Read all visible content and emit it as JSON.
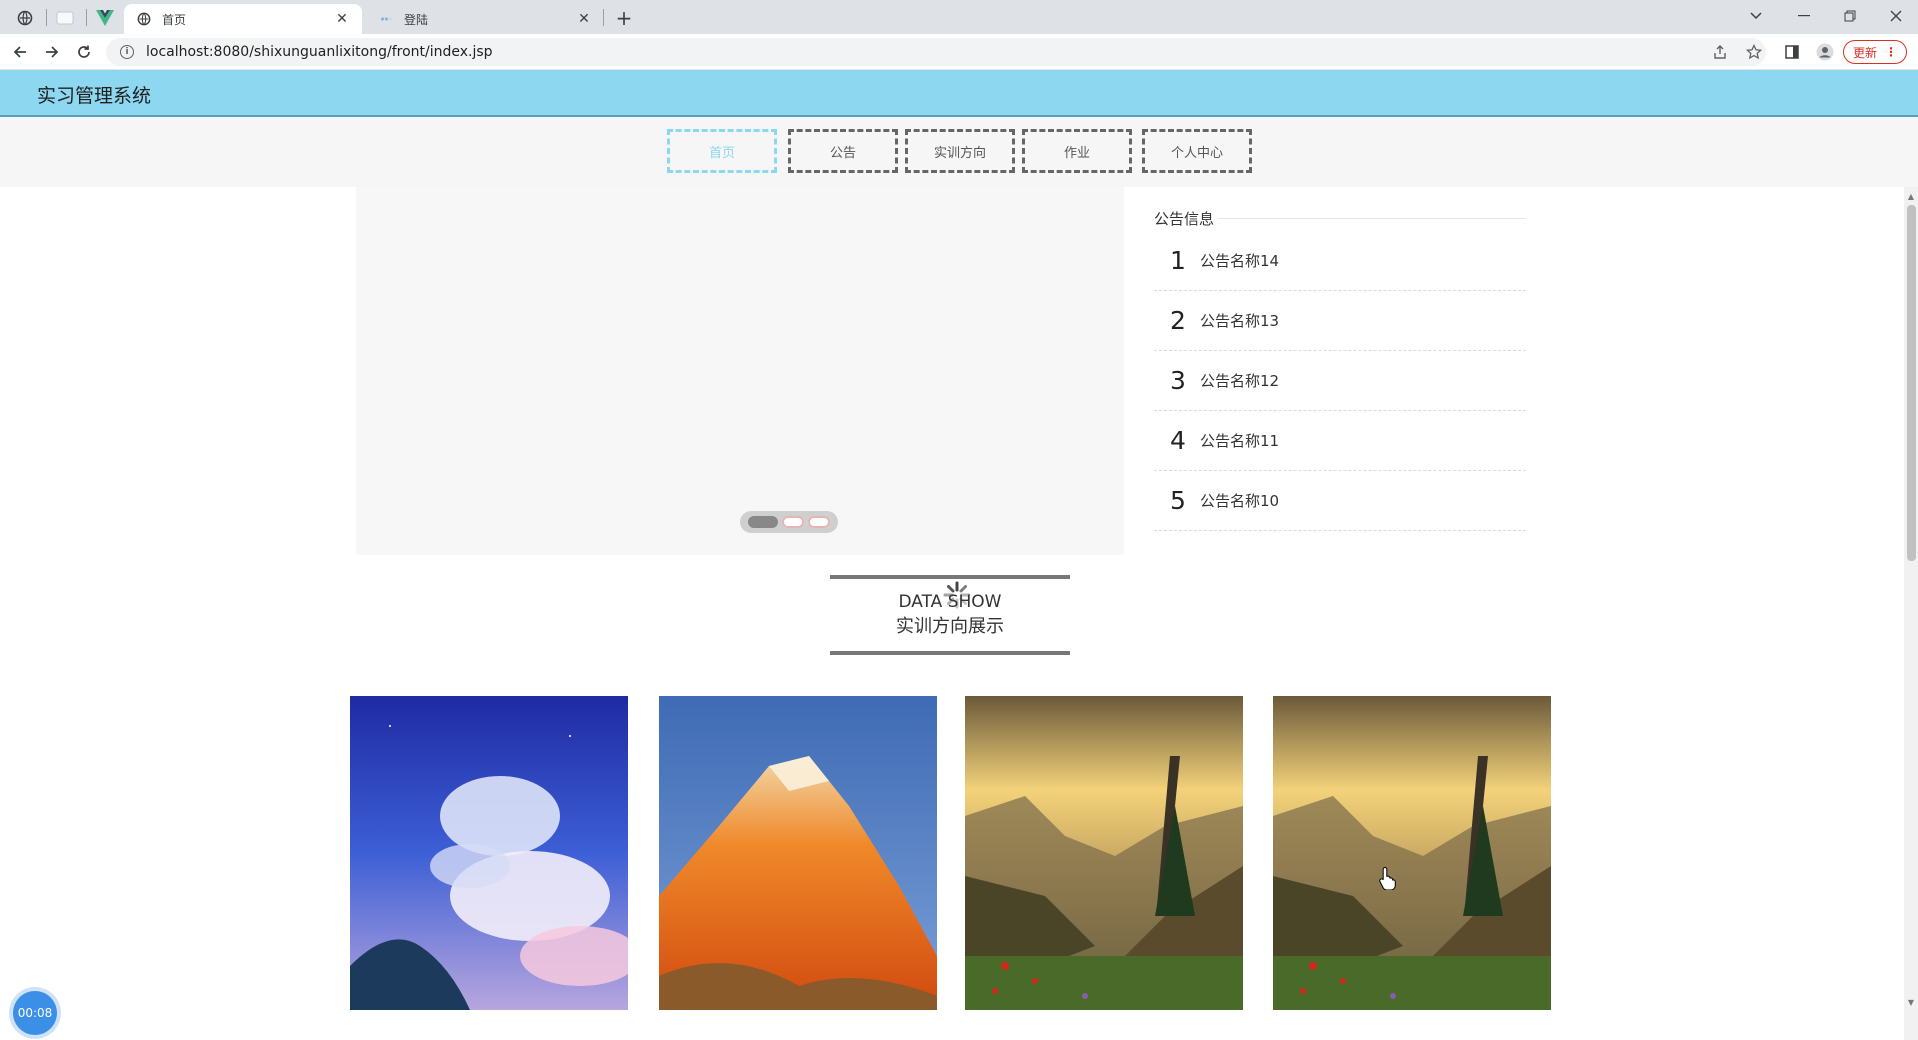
{
  "browser": {
    "tabs": [
      {
        "title": "首页",
        "active": true
      },
      {
        "title": "登陆",
        "active": false
      }
    ],
    "new_tab_label": "+",
    "url": "localhost:8080/shixunguanlixitong/front/index.jsp",
    "update_label": "更新"
  },
  "site": {
    "title": "实习管理系统",
    "nav": [
      {
        "label": "首页",
        "active": true
      },
      {
        "label": "公告",
        "active": false
      },
      {
        "label": "实训方向",
        "active": false
      },
      {
        "label": "作业",
        "active": false
      },
      {
        "label": "个人中心",
        "active": false
      }
    ],
    "carousel": {
      "slide_count": 3,
      "active_index": 0
    },
    "notices": {
      "heading": "公告信息",
      "items": [
        {
          "num": "1",
          "name": "公告名称14"
        },
        {
          "num": "2",
          "name": "公告名称13"
        },
        {
          "num": "3",
          "name": "公告名称12"
        },
        {
          "num": "4",
          "name": "公告名称11"
        },
        {
          "num": "5",
          "name": "公告名称10"
        }
      ]
    },
    "section": {
      "en": "DATA SHOW",
      "cn": "实训方向展示"
    },
    "gallery": [
      {
        "scene": "sky-clouds"
      },
      {
        "scene": "orange-mountain"
      },
      {
        "scene": "mountain-valley"
      },
      {
        "scene": "mountain-valley"
      }
    ]
  },
  "recorder": {
    "timer": "00:08"
  },
  "colors": {
    "accent": "#8dd7f0",
    "header_bg": "#8dd7f0",
    "update": "#d93025"
  }
}
